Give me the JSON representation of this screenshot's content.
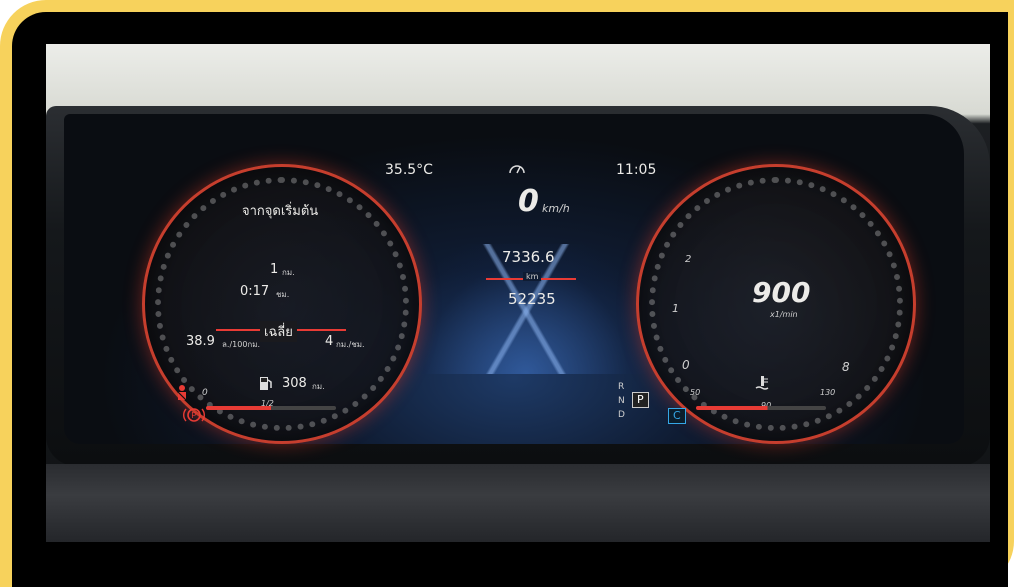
{
  "temperature": "35.5°C",
  "clock": "11:05",
  "speed": {
    "value": "0",
    "unit": "km/h"
  },
  "trip": {
    "label": "จากจุดเริ่มต้น",
    "distance": "1",
    "distance_unit": "กม.",
    "time": "0:17",
    "time_unit": "ชม."
  },
  "average": {
    "label": "เฉลี่ย",
    "consumption": "38.9",
    "consumption_unit": "ล./100กม.",
    "speed": "4",
    "speed_unit": "กม./ชม."
  },
  "fuel": {
    "range": "308",
    "range_unit": "กม.",
    "level_label": "1/2",
    "scale_zero": "0"
  },
  "odometer": {
    "trip": "7336.6",
    "km_label": "km",
    "total": "52235"
  },
  "tachometer": {
    "rpm": "900",
    "unit": "x1/min",
    "ticks": [
      "0",
      "1",
      "2",
      "8"
    ]
  },
  "coolant": {
    "ticks": [
      "50",
      "90",
      "130"
    ]
  },
  "gears": {
    "labels": [
      "R",
      "N",
      "D"
    ],
    "selected": "P",
    "mode": "C"
  },
  "colors": {
    "accent": "#e83b35",
    "frame": "#f7d25c",
    "mode_blue": "#35a7e6"
  }
}
